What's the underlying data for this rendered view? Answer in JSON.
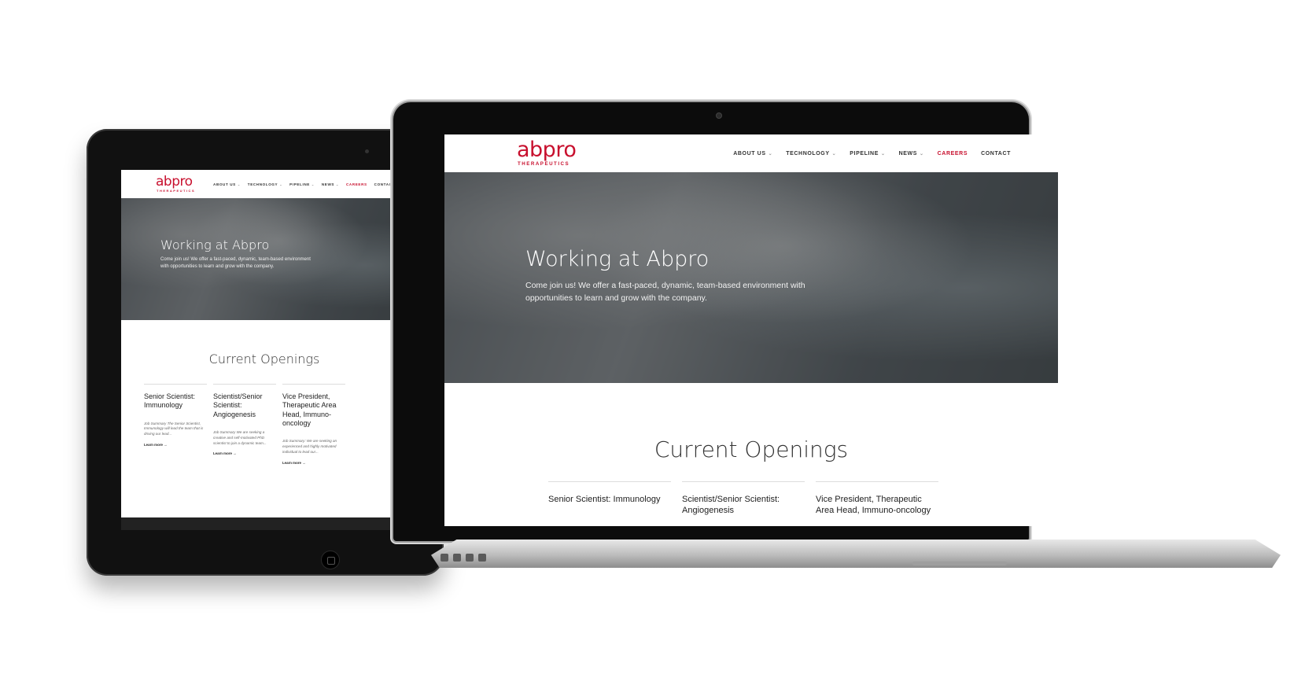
{
  "site": {
    "logo": {
      "word": "abpro",
      "sub": "THERAPEUTICS"
    },
    "nav": [
      {
        "label": "ABOUT US",
        "has_caret": true,
        "active": false
      },
      {
        "label": "TECHNOLOGY",
        "has_caret": true,
        "active": false
      },
      {
        "label": "PIPELINE",
        "has_caret": true,
        "active": false
      },
      {
        "label": "NEWS",
        "has_caret": true,
        "active": false
      },
      {
        "label": "CAREERS",
        "has_caret": false,
        "active": true
      },
      {
        "label": "CONTACT",
        "has_caret": false,
        "active": false
      }
    ],
    "caret_glyph": "⌄",
    "hero": {
      "title": "Working at Abpro",
      "text": "Come join us! We offer a fast-paced, dynamic, team-based environment with opportunities to learn and grow with the company."
    },
    "openings_title": "Current Openings",
    "jobs": [
      {
        "title": "Senior Scientist: Immunology",
        "summary": "Job Summary The Senior Scientist, Immunology will lead the team that is driving our lead...",
        "link": "Learn more →"
      },
      {
        "title": "Scientist/Senior Scientist: Angiogenesis",
        "summary": "Job Summary We are seeking a creative and self-motivated PhD scientist to join a dynamic team...",
        "link": "Learn more →"
      },
      {
        "title": "Vice President, Therapeutic Area Head, Immuno-oncology",
        "summary": "Job Summary: We are seeking an experienced and highly motivated individual to lead our...",
        "link": "Learn more →"
      }
    ]
  },
  "colors": {
    "brand_red": "#c8102e",
    "device_black": "#111111",
    "laptop_silver": "#c8c8c8"
  },
  "icons": {
    "tablet_home": "home-button-icon",
    "camera": "camera-icon"
  }
}
